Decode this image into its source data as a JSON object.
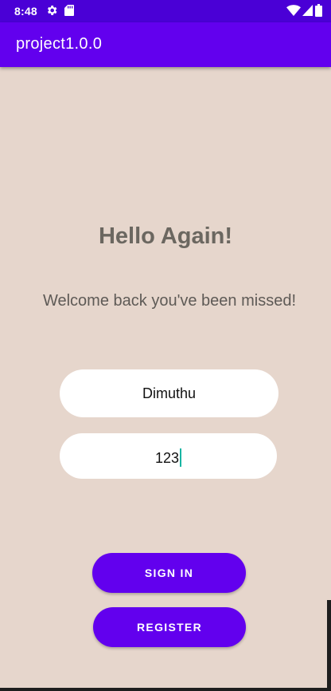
{
  "status_bar": {
    "time": "8:48",
    "icons": [
      "settings-gear-icon",
      "sd-card-icon",
      "wifi-icon",
      "cell-signal-icon",
      "battery-icon"
    ],
    "background": "#4a00d6"
  },
  "app_bar": {
    "title": "project1.0.0",
    "background": "#6200ee"
  },
  "screen": {
    "background": "#e6d6cc",
    "heading": "Hello Again!",
    "subheading": "Welcome back you've been missed!"
  },
  "form": {
    "username_value": "Dimuthu",
    "password_value": "123"
  },
  "buttons": {
    "sign_in_label": "SIGN IN",
    "register_label": "REGISTER",
    "color": "#6200ee"
  }
}
